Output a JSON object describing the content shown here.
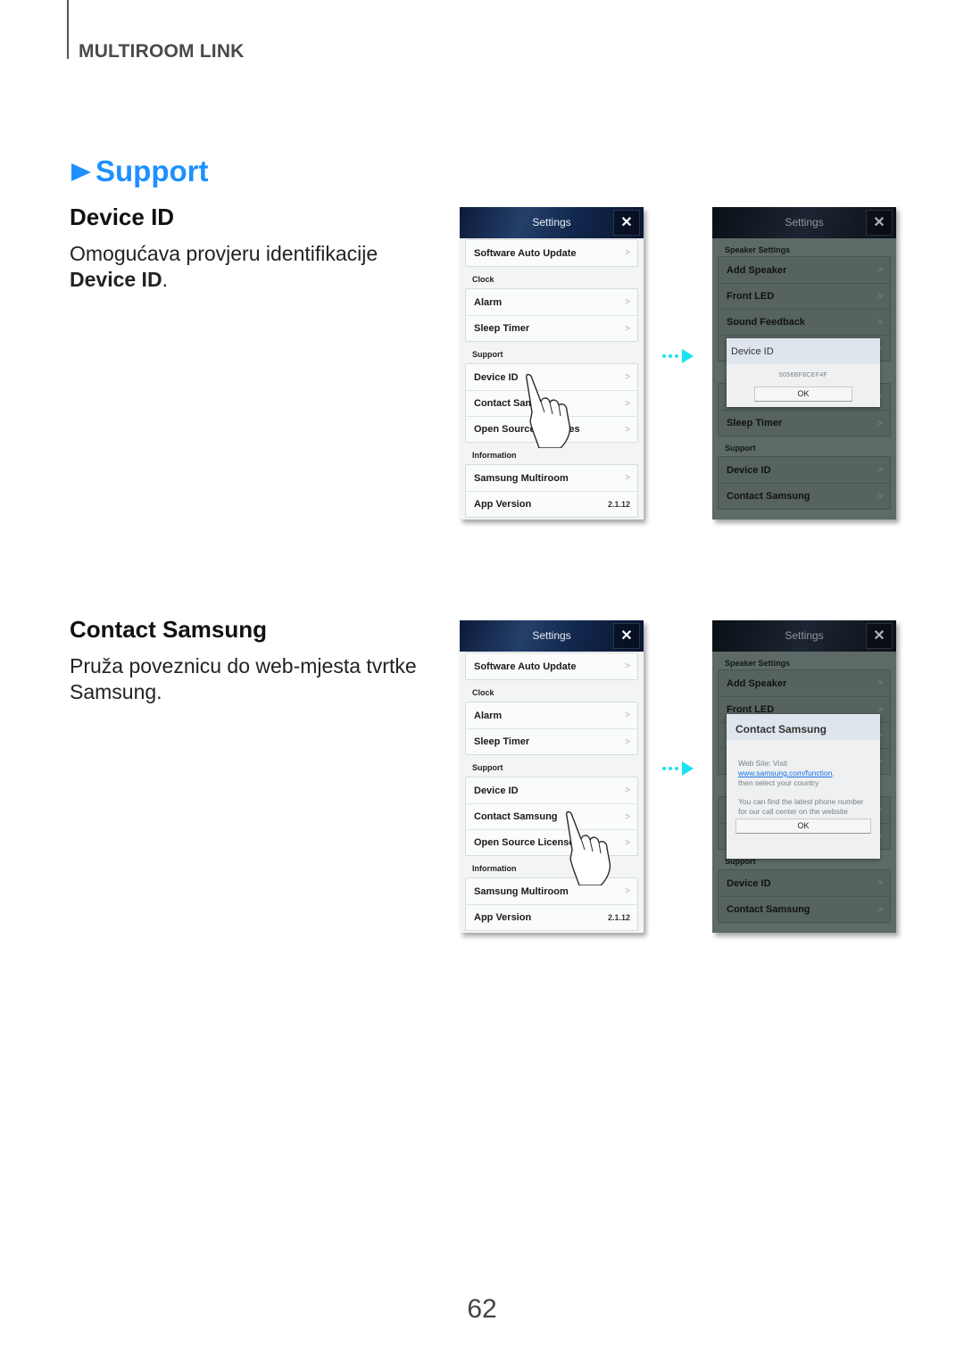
{
  "header": {
    "section_label": "MULTIROOM LINK"
  },
  "section": {
    "title": "Support",
    "bullet_icon": "triangle-right-icon",
    "accent_color": "#1e90ff"
  },
  "items": [
    {
      "title": "Device ID",
      "description_prefix": "Omogućava provjeru identifikacije",
      "description_bold": "Device ID",
      "description_suffix": "."
    },
    {
      "title": "Contact Samsung",
      "description": "Pruža poveznicu do web-mjesta tvrtke Samsung."
    }
  ],
  "screen_settings": {
    "title": "Settings",
    "close_icon": "close-icon",
    "top_item": "Software Auto Update",
    "groups": [
      {
        "label": "Clock",
        "items": [
          "Alarm",
          "Sleep Timer"
        ]
      },
      {
        "label": "Support",
        "items": [
          "Device ID",
          "Contact Samsung",
          "Open Source Licenses"
        ]
      },
      {
        "label": "Information",
        "items": [
          "Samsung Multiroom",
          "App Version"
        ]
      }
    ],
    "app_version": "2.1.12"
  },
  "screen_dimmed": {
    "title": "Settings",
    "speaker_group_label": "Speaker Settings",
    "speaker_items": [
      "Add Speaker",
      "Front LED",
      "Sound Feedback"
    ],
    "sleep_timer": "Sleep Timer",
    "support_label": "Support",
    "support_items": [
      "Device ID",
      "Contact Samsung"
    ]
  },
  "dialog_device_id": {
    "title": "Device ID",
    "value": "5056BF8CEF4F",
    "ok_label": "OK"
  },
  "dialog_contact": {
    "title": "Contact Samsung",
    "line1": "Web Site: Visit",
    "link": "www.samsung.com/function",
    "line2_suffix": ",",
    "line3": "then select your country",
    "note": "You can find the latest phone number for our call center on the website",
    "ok_label": "OK",
    "link_color": "#1a73e8"
  },
  "arrow_color": "#19e3f0",
  "page_number": "62"
}
